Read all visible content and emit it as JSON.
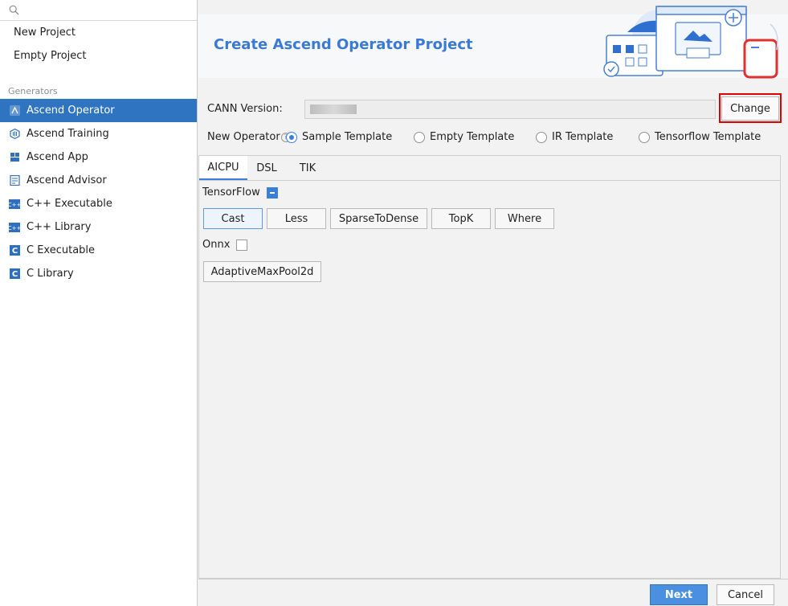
{
  "sidebar": {
    "search_icon": "search-icon",
    "top_items": [
      "New Project",
      "Empty Project"
    ],
    "generators_label": "Generators",
    "generators": [
      {
        "label": "Ascend Operator",
        "icon": "ascend-operator-icon",
        "selected": true
      },
      {
        "label": "Ascend Training",
        "icon": "ascend-training-icon"
      },
      {
        "label": "Ascend App",
        "icon": "ascend-app-icon"
      },
      {
        "label": "Ascend Advisor",
        "icon": "ascend-advisor-icon"
      },
      {
        "label": "C++ Executable",
        "icon": "cpp-icon"
      },
      {
        "label": "C++ Library",
        "icon": "cpp-icon"
      },
      {
        "label": "C Executable",
        "icon": "c-icon"
      },
      {
        "label": "C Library",
        "icon": "c-icon"
      }
    ]
  },
  "banner": {
    "title": "Create Ascend Operator Project"
  },
  "cann": {
    "label": "CANN Version:",
    "change_label": "Change"
  },
  "new_operator": {
    "label": "New Operator",
    "options": [
      "Sample Template",
      "Empty Template",
      "IR Template",
      "Tensorflow Template"
    ],
    "selected": "Sample Template"
  },
  "tabs": [
    "AICPU",
    "DSL",
    "TIK"
  ],
  "active_tab": "AICPU",
  "groups": [
    {
      "label": "TensorFlow",
      "ops": [
        "Cast",
        "Less",
        "SparseToDense",
        "TopK",
        "Where"
      ]
    },
    {
      "label": "Onnx",
      "ops": [
        "AdaptiveMaxPool2d"
      ]
    }
  ],
  "footer": {
    "next_label": "Next",
    "cancel_label": "Cancel"
  },
  "colors": {
    "accent": "#2f74c0",
    "title": "#3a7ad6",
    "highlight": "#e00000"
  }
}
